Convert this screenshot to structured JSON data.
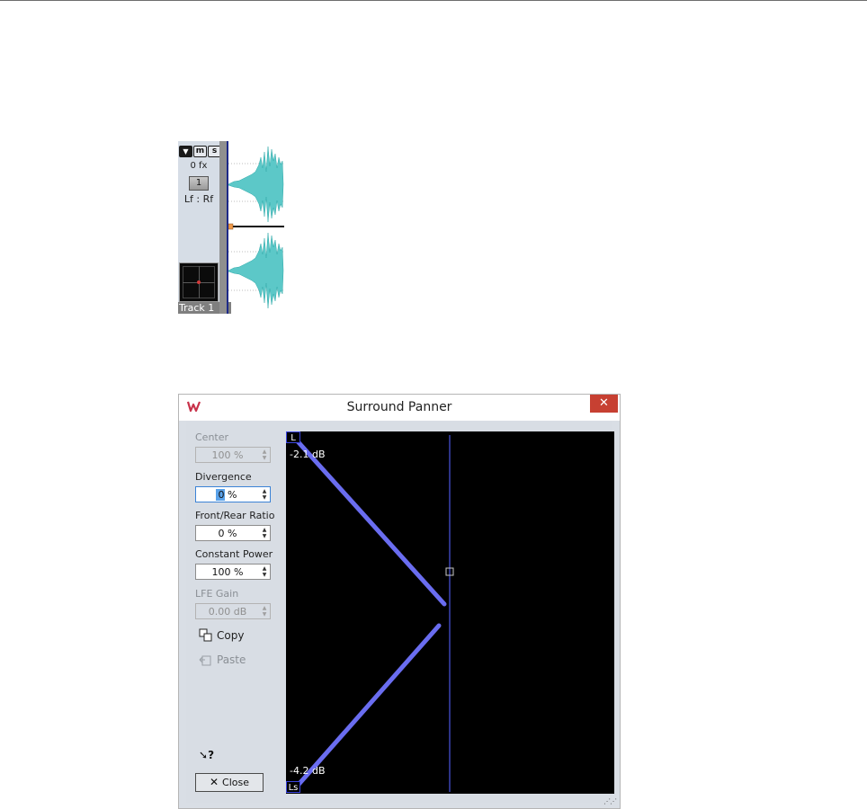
{
  "track": {
    "fx_count": "0 fx",
    "channel_button": "1",
    "routing": "Lf : Rf",
    "name": "Track 1",
    "header_buttons": [
      "m",
      "s"
    ]
  },
  "dialog": {
    "title": "Surround Panner",
    "close_glyph": "✕",
    "controls": [
      {
        "label": "Center",
        "value": "100 %",
        "enabled": false
      },
      {
        "label": "Divergence",
        "value": "0 %",
        "enabled": true
      },
      {
        "label": "Front/Rear Ratio",
        "value": "0 %",
        "enabled": true
      },
      {
        "label": "Constant Power",
        "value": "100 %",
        "enabled": true
      },
      {
        "label": "LFE Gain",
        "value": "0.00 dB",
        "enabled": false
      }
    ],
    "copy_label": "Copy",
    "paste_label": "Paste",
    "help_glyph": "?",
    "close_button_label": "Close",
    "close_button_glyph": "✕"
  },
  "panner": {
    "speakers": [
      "L",
      "Ls"
    ],
    "level_top": "-2.1 dB",
    "level_bottom": "-4.2 dB",
    "line_color": "#6a6df0"
  }
}
